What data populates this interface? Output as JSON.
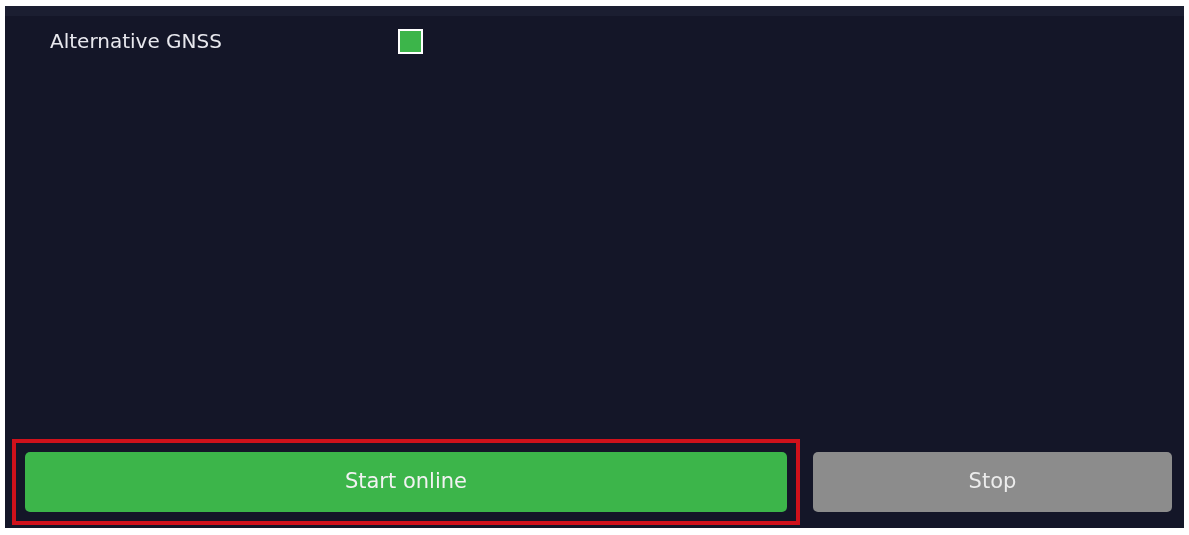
{
  "option": {
    "label": "Alternative GNSS",
    "checked": true
  },
  "buttons": [
    {
      "label": "Start online",
      "disabled": false,
      "highlighted": true
    },
    {
      "label": "Stop",
      "disabled": true,
      "highlighted": false
    }
  ]
}
